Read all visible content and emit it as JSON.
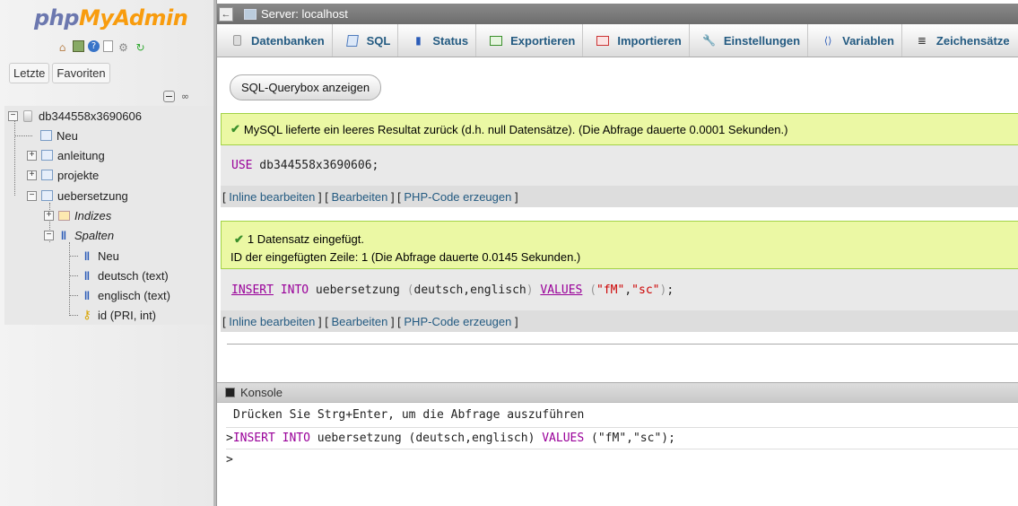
{
  "logo": {
    "part1": "php",
    "part2": "MyAdmin"
  },
  "nav": {
    "icons": [
      "home-icon",
      "database-icon",
      "help-icon",
      "docs-icon",
      "settings-icon",
      "reload-icon"
    ],
    "tabs": [
      "Letzte",
      "Favoriten"
    ],
    "tree": {
      "db": "db344558x3690606",
      "db_new": "Neu",
      "tables": [
        "anleitung",
        "projekte",
        "uebersetzung"
      ],
      "indizes": "Indizes",
      "spalten": "Spalten",
      "spalten_new": "Neu",
      "columns": [
        "deutsch (text)",
        "englisch (text)",
        "id (PRI, int)"
      ]
    }
  },
  "topbar": {
    "back": "←",
    "server": "Server: localhost"
  },
  "menu": [
    "Datenbanken",
    "SQL",
    "Status",
    "Exportieren",
    "Importieren",
    "Einstellungen",
    "Variablen",
    "Zeichensätze"
  ],
  "querybox_button": "SQL-Querybox anzeigen",
  "messages": [
    {
      "line1": "MySQL lieferte ein leeres Resultat zurück (d.h. null Datensätze). (Die Abfrage dauerte 0.0001 Sekunden.)"
    },
    {
      "line1": "1 Datensatz eingefügt.",
      "line2": "ID der eingefügten Zeile: 1 (Die Abfrage dauerte 0.0145 Sekunden.)"
    }
  ],
  "sql1": {
    "kw": "USE",
    "rest": " db344558x3690606;"
  },
  "sql2": {
    "insert": "INSERT",
    "into": "INTO",
    "table": " uebersetzung ",
    "open": "(",
    "cols": "deutsch,englisch",
    "close": ")",
    "values": "VALUES",
    "v1": "\"fM\"",
    "comma": ",",
    "v2": "\"sc\"",
    "end": ";"
  },
  "actions": {
    "bracket_open": "[ ",
    "sep": " ] [ ",
    "bracket_close": " ]",
    "inline_edit": "Inline bearbeiten",
    "edit": "Bearbeiten",
    "php_code": "PHP-Code erzeugen"
  },
  "console": {
    "title": "Konsole",
    "hint": "Drücken Sie Strg+Enter, um die Abfrage auszuführen",
    "prompt": ">",
    "history": {
      "insert": "INSERT",
      "into": "INTO",
      "mid": " uebersetzung (deutsch,englisch) ",
      "values": "VALUES",
      "tail": " (\"fM\",\"sc\");"
    }
  }
}
